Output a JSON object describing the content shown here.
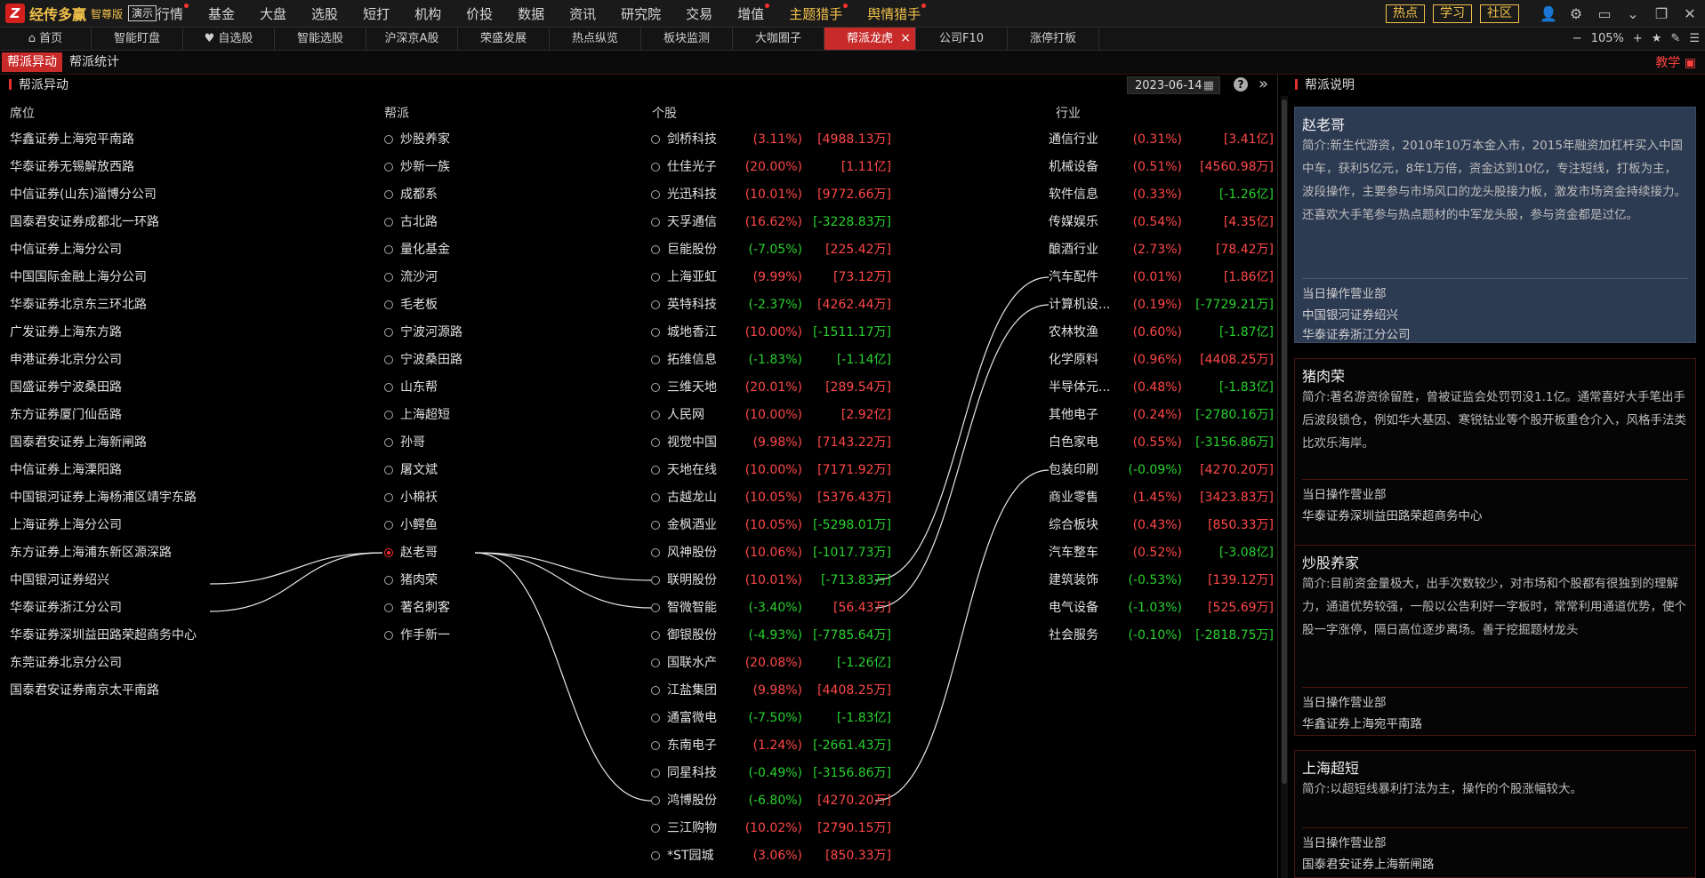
{
  "app": {
    "logo_mark": "Z",
    "name": "经传多赢",
    "edition": "智尊版",
    "demo": "演示"
  },
  "menu": [
    {
      "label": "行情",
      "dot": true
    },
    {
      "label": "基金",
      "dot": false
    },
    {
      "label": "大盘",
      "dot": false
    },
    {
      "label": "选股",
      "dot": false
    },
    {
      "label": "短打",
      "dot": false
    },
    {
      "label": "机构",
      "dot": false
    },
    {
      "label": "价投",
      "dot": false
    },
    {
      "label": "数据",
      "dot": false
    },
    {
      "label": "资讯",
      "dot": false
    },
    {
      "label": "研究院",
      "dot": false
    },
    {
      "label": "交易",
      "dot": false
    },
    {
      "label": "增值",
      "dot": true
    },
    {
      "label": "主题猎手",
      "dot": true,
      "highlight": true
    },
    {
      "label": "舆情猎手",
      "dot": true,
      "highlight": true
    }
  ],
  "top_right": {
    "pills": [
      "热点",
      "学习",
      "社区"
    ],
    "icons": [
      "user-icon",
      "gear-icon",
      "window-icon",
      "chevron-down-icon",
      "restore-icon",
      "close-icon"
    ]
  },
  "tabs": [
    {
      "label": "⌂ 首页"
    },
    {
      "label": "智能盯盘"
    },
    {
      "label": "♥ 自选股"
    },
    {
      "label": "智能选股"
    },
    {
      "label": "沪深京A股"
    },
    {
      "label": "荣盛发展"
    },
    {
      "label": "热点纵览"
    },
    {
      "label": "板块监测"
    },
    {
      "label": "大咖圈子"
    },
    {
      "label": "帮派龙虎",
      "active": true
    },
    {
      "label": "公司F10"
    },
    {
      "label": "涨停打板"
    }
  ],
  "tab_close": "×",
  "zoom": {
    "minus": "−",
    "value": "105%",
    "plus": "+",
    "star": "★",
    "pen": "✎",
    "list": "☰"
  },
  "subtabs": [
    "帮派异动",
    "帮派统计"
  ],
  "teach_label": "教学",
  "left_panel": {
    "title": "帮派异动",
    "date": "2023-06-14",
    "help": "?",
    "expand": "»",
    "columns": {
      "seat": "席位",
      "group": "帮派",
      "stock": "个股",
      "industry": "行业"
    }
  },
  "seats": [
    "华鑫证券上海宛平南路",
    "华泰证券无锡解放西路",
    "中信证券(山东)淄博分公司",
    "国泰君安证券成都北一环路",
    "中信证券上海分公司",
    "中国国际金融上海分公司",
    "华泰证券北京东三环北路",
    "广发证券上海东方路",
    "申港证券北京分公司",
    "国盛证券宁波桑田路",
    "东方证券厦门仙岳路",
    "国泰君安证券上海新闸路",
    "中信证券上海溧阳路",
    "中国银河证券上海杨浦区靖宇东路",
    "上海证券上海分公司",
    "东方证券上海浦东新区源深路",
    "中国银河证券绍兴",
    "华泰证券浙江分公司",
    "华泰证券深圳益田路荣超商务中心",
    "东莞证券北京分公司",
    "国泰君安证券南京太平南路"
  ],
  "groups": [
    {
      "name": "炒股养家"
    },
    {
      "name": "炒新一族"
    },
    {
      "name": "成都系"
    },
    {
      "name": "古北路"
    },
    {
      "name": "量化基金"
    },
    {
      "name": "流沙河"
    },
    {
      "name": "毛老板"
    },
    {
      "name": "宁波河源路"
    },
    {
      "name": "宁波桑田路"
    },
    {
      "name": "山东帮"
    },
    {
      "name": "上海超短"
    },
    {
      "name": "孙哥"
    },
    {
      "name": "屠文斌"
    },
    {
      "name": "小棉袄"
    },
    {
      "name": "小鳄鱼"
    },
    {
      "name": "赵老哥",
      "selected": true
    },
    {
      "name": "猪肉荣"
    },
    {
      "name": "著名刺客"
    },
    {
      "name": "作手新一"
    }
  ],
  "stocks": [
    {
      "name": "剑桥科技",
      "pct": "(3.11%)",
      "amt": "[4988.13万]",
      "dir": "up"
    },
    {
      "name": "仕佳光子",
      "pct": "(20.00%)",
      "amt": "[1.11亿]",
      "dir": "up"
    },
    {
      "name": "光迅科技",
      "pct": "(10.01%)",
      "amt": "[9772.66万]",
      "dir": "up"
    },
    {
      "name": "天孚通信",
      "pct": "(16.62%)",
      "amt": "[-3228.83万]",
      "dir": "up",
      "amt_dir": "dn"
    },
    {
      "name": "巨能股份",
      "pct": "(-7.05%)",
      "amt": "[225.42万]",
      "dir": "dn",
      "amt_dir": "up"
    },
    {
      "name": "上海亚虹",
      "pct": "(9.99%)",
      "amt": "[73.12万]",
      "dir": "up"
    },
    {
      "name": "英特科技",
      "pct": "(-2.37%)",
      "amt": "[4262.44万]",
      "dir": "dn",
      "amt_dir": "up"
    },
    {
      "name": "城地香江",
      "pct": "(10.00%)",
      "amt": "[-1511.17万]",
      "dir": "up",
      "amt_dir": "dn"
    },
    {
      "name": "拓维信息",
      "pct": "(-1.83%)",
      "amt": "[-1.14亿]",
      "dir": "dn"
    },
    {
      "name": "三维天地",
      "pct": "(20.01%)",
      "amt": "[289.54万]",
      "dir": "up"
    },
    {
      "name": "人民网",
      "pct": "(10.00%)",
      "amt": "[2.92亿]",
      "dir": "up"
    },
    {
      "name": "视觉中国",
      "pct": "(9.98%)",
      "amt": "[7143.22万]",
      "dir": "up"
    },
    {
      "name": "天地在线",
      "pct": "(10.00%)",
      "amt": "[7171.92万]",
      "dir": "up"
    },
    {
      "name": "古越龙山",
      "pct": "(10.05%)",
      "amt": "[5376.43万]",
      "dir": "up"
    },
    {
      "name": "金枫酒业",
      "pct": "(10.05%)",
      "amt": "[-5298.01万]",
      "dir": "up",
      "amt_dir": "dn"
    },
    {
      "name": "风神股份",
      "pct": "(10.06%)",
      "amt": "[-1017.73万]",
      "dir": "up",
      "amt_dir": "dn"
    },
    {
      "name": "联明股份",
      "pct": "(10.01%)",
      "amt": "[-713.83万]",
      "dir": "up",
      "amt_dir": "dn"
    },
    {
      "name": "智微智能",
      "pct": "(-3.40%)",
      "amt": "[56.43万]",
      "dir": "dn",
      "amt_dir": "up"
    },
    {
      "name": "御银股份",
      "pct": "(-4.93%)",
      "amt": "[-7785.64万]",
      "dir": "dn"
    },
    {
      "name": "国联水产",
      "pct": "(20.08%)",
      "amt": "[-1.26亿]",
      "dir": "up",
      "amt_dir": "dn"
    },
    {
      "name": "江盐集团",
      "pct": "(9.98%)",
      "amt": "[4408.25万]",
      "dir": "up"
    },
    {
      "name": "通富微电",
      "pct": "(-7.50%)",
      "amt": "[-1.83亿]",
      "dir": "dn"
    },
    {
      "name": "东南电子",
      "pct": "(1.24%)",
      "amt": "[-2661.43万]",
      "dir": "up",
      "amt_dir": "dn"
    },
    {
      "name": "同星科技",
      "pct": "(-0.49%)",
      "amt": "[-3156.86万]",
      "dir": "dn"
    },
    {
      "name": "鸿博股份",
      "pct": "(-6.80%)",
      "amt": "[4270.20万]",
      "dir": "dn",
      "amt_dir": "up"
    },
    {
      "name": "三江购物",
      "pct": "(10.02%)",
      "amt": "[2790.15万]",
      "dir": "up"
    },
    {
      "name": "*ST园城",
      "pct": "(3.06%)",
      "amt": "[850.33万]",
      "dir": "up"
    }
  ],
  "industries": [
    {
      "name": "通信行业",
      "pct": "(0.31%)",
      "amt": "[3.41亿]",
      "dir": "up"
    },
    {
      "name": "机械设备",
      "pct": "(0.51%)",
      "amt": "[4560.98万]",
      "dir": "up"
    },
    {
      "name": "软件信息",
      "pct": "(0.33%)",
      "amt": "[-1.26亿]",
      "dir": "up",
      "amt_dir": "dn"
    },
    {
      "name": "传媒娱乐",
      "pct": "(0.54%)",
      "amt": "[4.35亿]",
      "dir": "up"
    },
    {
      "name": "酿酒行业",
      "pct": "(2.73%)",
      "amt": "[78.42万]",
      "dir": "up"
    },
    {
      "name": "汽车配件",
      "pct": "(0.01%)",
      "amt": "[1.86亿]",
      "dir": "up"
    },
    {
      "name": "计算机设...",
      "pct": "(0.19%)",
      "amt": "[-7729.21万]",
      "dir": "up",
      "amt_dir": "dn"
    },
    {
      "name": "农林牧渔",
      "pct": "(0.60%)",
      "amt": "[-1.87亿]",
      "dir": "up",
      "amt_dir": "dn"
    },
    {
      "name": "化学原料",
      "pct": "(0.96%)",
      "amt": "[4408.25万]",
      "dir": "up"
    },
    {
      "name": "半导体元...",
      "pct": "(0.48%)",
      "amt": "[-1.83亿]",
      "dir": "up",
      "amt_dir": "dn"
    },
    {
      "name": "其他电子",
      "pct": "(0.24%)",
      "amt": "[-2780.16万]",
      "dir": "up",
      "amt_dir": "dn"
    },
    {
      "name": "白色家电",
      "pct": "(0.55%)",
      "amt": "[-3156.86万]",
      "dir": "up",
      "amt_dir": "dn"
    },
    {
      "name": "包装印刷",
      "pct": "(-0.09%)",
      "amt": "[4270.20万]",
      "dir": "dn",
      "amt_dir": "up"
    },
    {
      "name": "商业零售",
      "pct": "(1.45%)",
      "amt": "[3423.83万]",
      "dir": "up"
    },
    {
      "name": "综合板块",
      "pct": "(0.43%)",
      "amt": "[850.33万]",
      "dir": "up"
    },
    {
      "name": "汽车整车",
      "pct": "(0.52%)",
      "amt": "[-3.08亿]",
      "dir": "up",
      "amt_dir": "dn"
    },
    {
      "name": "建筑装饰",
      "pct": "(-0.53%)",
      "amt": "[139.12万]",
      "dir": "dn",
      "amt_dir": "up"
    },
    {
      "name": "电气设备",
      "pct": "(-1.03%)",
      "amt": "[525.69万]",
      "dir": "dn",
      "amt_dir": "up"
    },
    {
      "name": "社会服务",
      "pct": "(-0.10%)",
      "amt": "[-2818.75万]",
      "dir": "dn"
    }
  ],
  "links": {
    "seat_to_group": [
      [
        16,
        15
      ],
      [
        17,
        15
      ]
    ],
    "group_to_stock": [
      [
        15,
        16
      ],
      [
        15,
        17
      ],
      [
        15,
        24
      ]
    ],
    "stock_to_industry": [
      [
        16,
        5
      ],
      [
        17,
        6
      ],
      [
        24,
        12
      ]
    ]
  },
  "right_panel": {
    "title": "帮派说明",
    "cards": [
      {
        "name": "赵老哥",
        "intro": "简介:新生代游资，2010年10万本金入市，2015年融资加杠杆买入中国中车，获利5亿元，8年1万倍，资金达到10亿，专注短线，打板为主，波段操作，主要参与市场风口的龙头股接力板，激发市场资金持续接力。还喜欢大手笔参与热点题材的中军龙头股，参与资金都是过亿。",
        "deps_title": "当日操作营业部",
        "deps": [
          "中国银河证券绍兴",
          "华泰证券浙江分公司"
        ],
        "active": true
      },
      {
        "name": "猪肉荣",
        "intro": "简介:著名游资徐留胜，曾被证监会处罚罚没1.1亿。通常喜好大手笔出手后波段锁仓，例如华大基因、寒锐钴业等个股开板重仓介入，风格手法类比欢乐海岸。",
        "deps_title": "当日操作营业部",
        "deps": [
          "华泰证券深圳益田路荣超商务中心"
        ]
      },
      {
        "name": "炒股养家",
        "intro": "简介:目前资金量极大，出手次数较少，对市场和个股都有很独到的理解力，通道优势较强，一般以公告利好一字板时，常常利用通道优势，使个股一字涨停，隔日高位逐步离场。善于挖掘题材龙头",
        "deps_title": "当日操作营业部",
        "deps": [
          "华鑫证券上海宛平南路"
        ]
      },
      {
        "name": "上海超短",
        "intro": "简介:以超短线暴利打法为主，操作的个股涨幅较大。",
        "deps_title": "当日操作营业部",
        "deps": [
          "国泰君安证券上海新闸路"
        ]
      }
    ]
  },
  "colors": {
    "up": "#ff4848",
    "down": "#29d12f",
    "accent": "#c82a2a",
    "gold": "#f2c14b"
  }
}
